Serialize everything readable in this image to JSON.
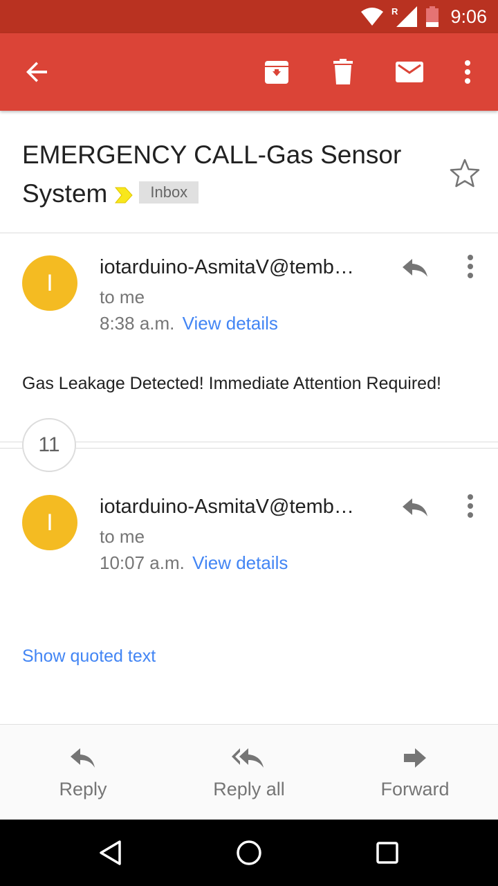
{
  "status_bar": {
    "time": "9:06",
    "icons": [
      "wifi-icon",
      "signal-roaming-icon",
      "battery-low-icon"
    ],
    "roaming_label": "R"
  },
  "toolbar": {
    "icons": [
      "back-arrow-icon",
      "archive-icon",
      "delete-icon",
      "mark-unread-icon",
      "more-vert-icon"
    ],
    "color": "#db4437"
  },
  "email": {
    "subject": "EMERGENCY CALL-Gas Sensor System",
    "label": "Inbox",
    "starred": false
  },
  "messages": [
    {
      "avatar_letter": "I",
      "sender": "iotarduino-AsmitaV@temb…",
      "recipient": "to me",
      "time": "8:38 a.m.",
      "details_link": "View details",
      "body": "Gas Leakage Detected! Immediate Attention Required!"
    },
    {
      "avatar_letter": "I",
      "sender": "iotarduino-AsmitaV@temb…",
      "recipient": "to me",
      "time": "10:07 a.m.",
      "details_link": "View details",
      "quoted_link": "Show quoted text"
    }
  ],
  "collapsed_count": "11",
  "actions": {
    "reply": "Reply",
    "reply_all": "Reply all",
    "forward": "Forward"
  },
  "nav_bar": {
    "icons": [
      "back-triangle-icon",
      "home-circle-icon",
      "recents-square-icon"
    ]
  },
  "colors": {
    "status_bar": "#b93221",
    "avatar": "#f4bb22",
    "link": "#4285f4"
  }
}
